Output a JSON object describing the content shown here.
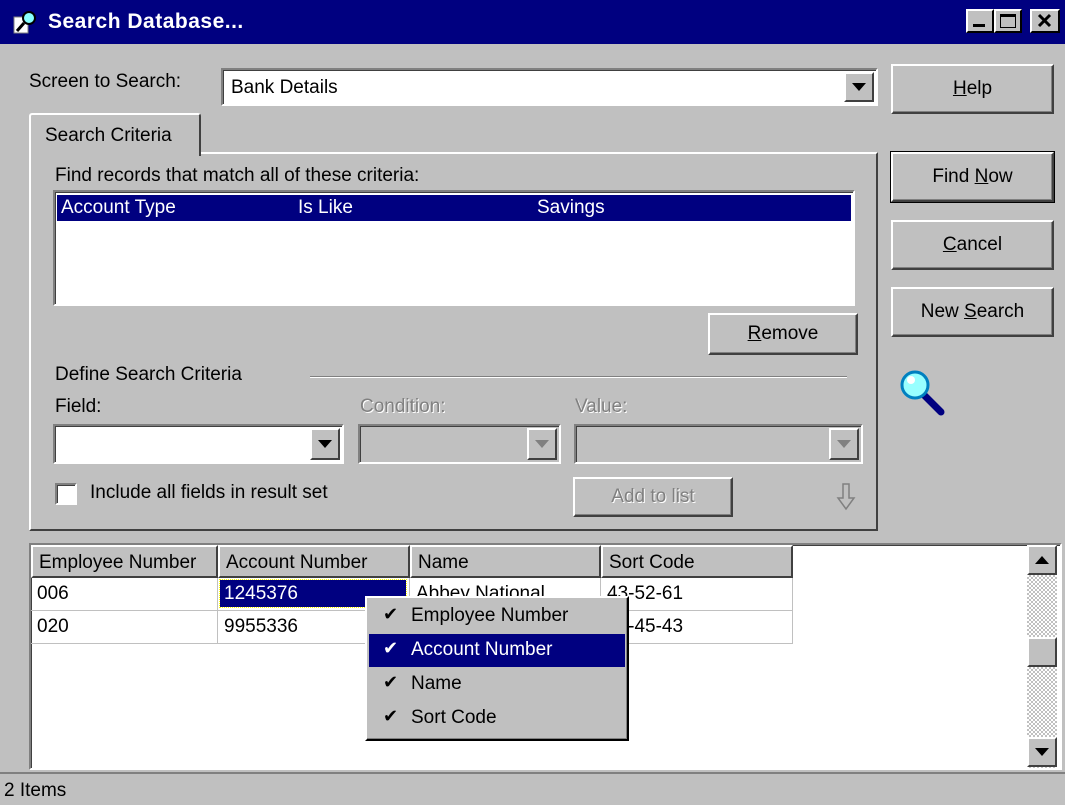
{
  "window": {
    "title": "Search Database..."
  },
  "screen_to_search": {
    "label": "Screen to Search:",
    "value": "Bank Details"
  },
  "buttons": {
    "help": {
      "underlined": "H",
      "rest": "elp"
    },
    "find_now": {
      "before": "Find ",
      "underlined": "N",
      "rest": "ow"
    },
    "cancel": {
      "underlined": "C",
      "rest": "ancel"
    },
    "new_search": {
      "before": "New ",
      "underlined": "S",
      "rest": "earch"
    },
    "remove": {
      "underlined": "R",
      "rest": "emove"
    },
    "add_to_list": "Add to list"
  },
  "tab": {
    "label": "Search Criteria"
  },
  "criteria": {
    "caption": "Find records that match all of these criteria:",
    "rows": [
      {
        "field": "Account Type",
        "condition": "Is Like",
        "value": "Savings"
      }
    ]
  },
  "define": {
    "heading": "Define Search Criteria",
    "field_label": "Field:",
    "condition_label": "Condition:",
    "value_label": "Value:",
    "include_all_label": "Include all fields in result set",
    "include_all_checked": false
  },
  "results": {
    "columns": [
      "Employee Number",
      "Account Number",
      "Name",
      "Sort Code"
    ],
    "rows": [
      [
        "006",
        "1245376",
        "Abbey National",
        "43-52-61"
      ],
      [
        "020",
        "9955336",
        "",
        "34-45-43"
      ]
    ],
    "selected_cell": "1245376"
  },
  "context_menu": {
    "items": [
      {
        "label": "Employee Number",
        "checked": true
      },
      {
        "label": "Account Number",
        "checked": true,
        "highlighted": true
      },
      {
        "label": "Name",
        "checked": true
      },
      {
        "label": "Sort Code",
        "checked": true
      }
    ]
  },
  "status": {
    "text": "2 Items"
  },
  "icons": [
    "app-search-icon",
    "magnifier-icon",
    "down-arrow-icon",
    "scroll-up-icon",
    "scroll-down-icon",
    "check-icon"
  ]
}
